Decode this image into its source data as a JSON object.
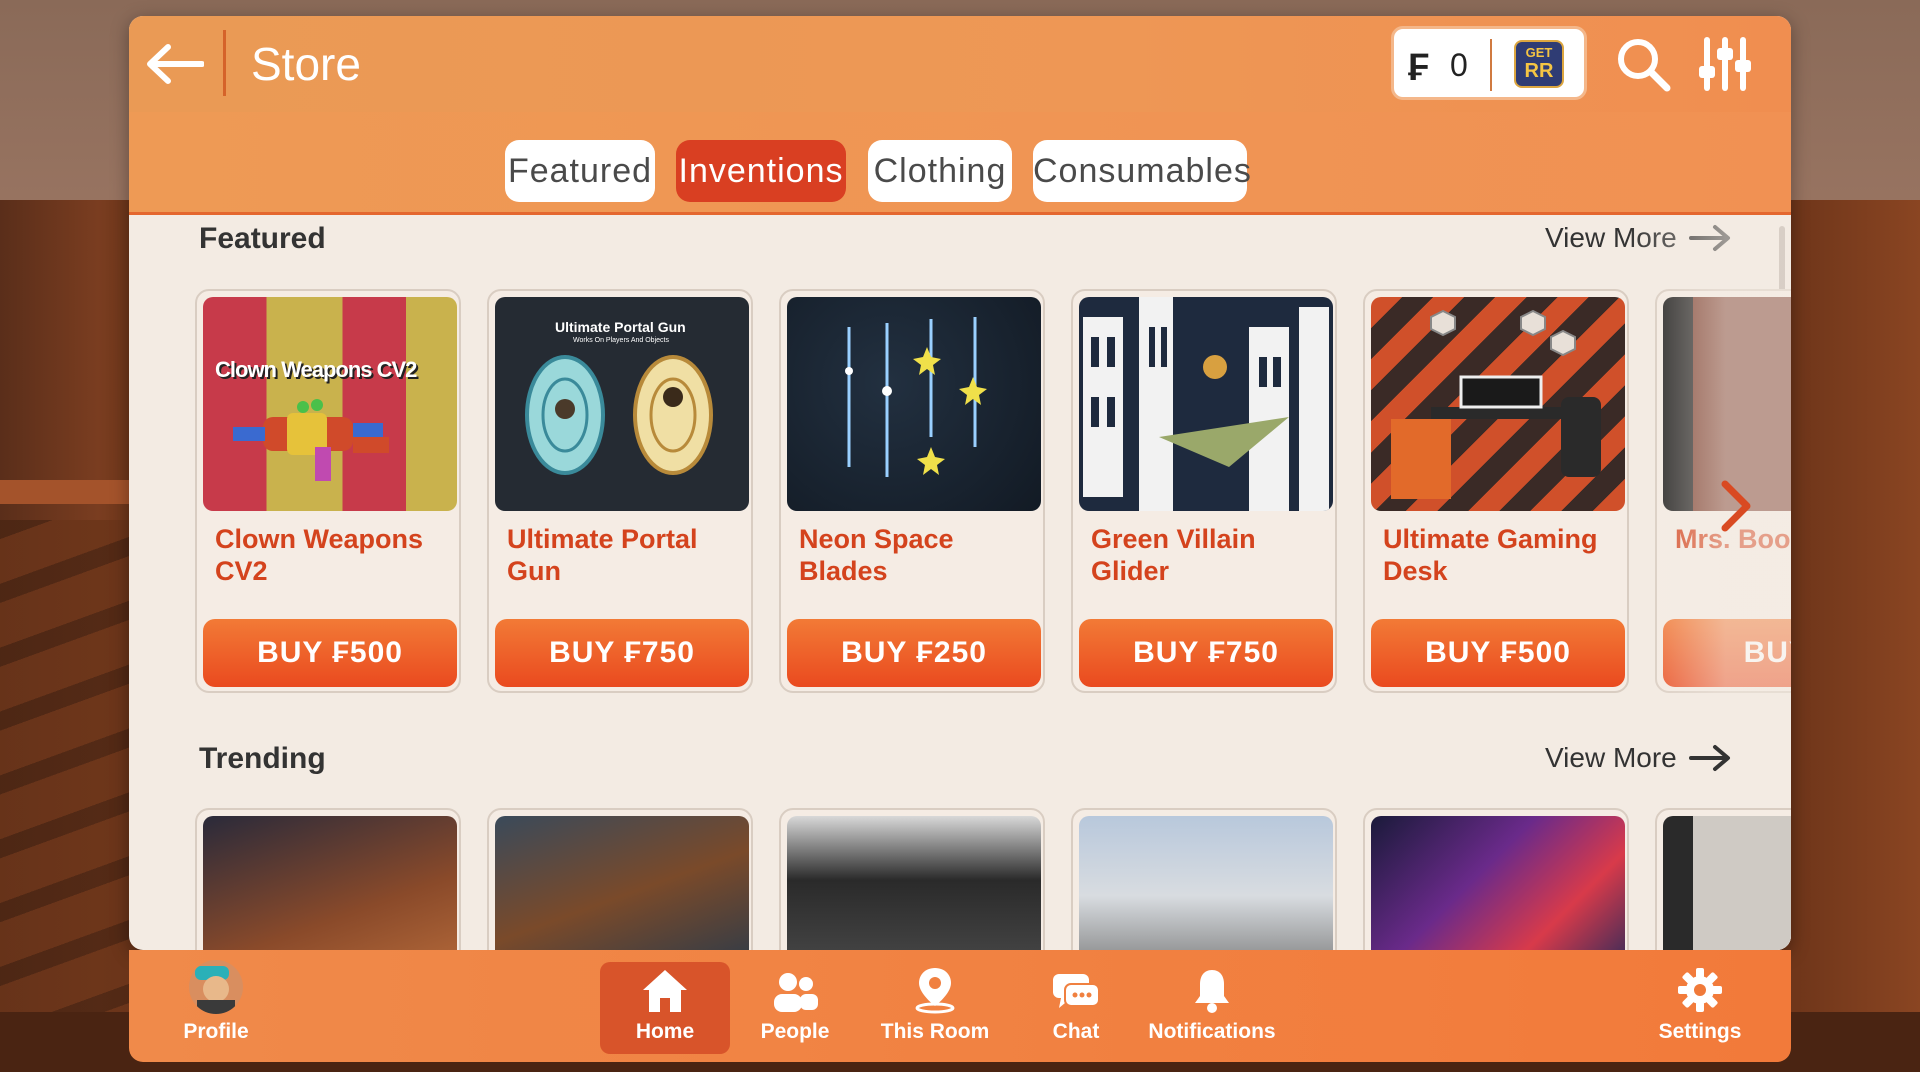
{
  "header": {
    "title": "Store",
    "currency_amount": "0",
    "currency_symbol": "₣",
    "get_rr_line1": "GET",
    "get_rr_line2": "RR"
  },
  "tabs": [
    {
      "label": "Featured",
      "active": false
    },
    {
      "label": "Inventions",
      "active": true
    },
    {
      "label": "Clothing",
      "active": false
    },
    {
      "label": "Consumables",
      "active": false
    }
  ],
  "featured": {
    "title": "Featured",
    "view_more": "View More",
    "items": [
      {
        "name": "Clown Weapons CV2",
        "buy": "BUY ₣500",
        "thumb_text": "Clown Weapons CV2"
      },
      {
        "name": "Ultimate Portal Gun",
        "buy": "BUY ₣750",
        "thumb_text": "Ultimate Portal Gun",
        "thumb_subtext": "Works On Players And Objects"
      },
      {
        "name": "Neon Space Blades",
        "buy": "BUY ₣250"
      },
      {
        "name": "Green Villain Glider",
        "buy": "BUY ₣750"
      },
      {
        "name": "Ultimate Gaming Desk",
        "buy": "BUY ₣500"
      },
      {
        "name": "Mrs. Boo",
        "buy": "BUY ₣"
      }
    ]
  },
  "trending": {
    "title": "Trending",
    "view_more": "View More"
  },
  "nav": {
    "profile": "Profile",
    "home": "Home",
    "people": "People",
    "this_room": "This Room",
    "chat": "Chat",
    "notifications": "Notifications",
    "settings": "Settings"
  },
  "colors": {
    "accent": "#ea4a1f",
    "active_tab": "#d93f22",
    "item_name": "#d4431d",
    "header": "#ee9755"
  }
}
